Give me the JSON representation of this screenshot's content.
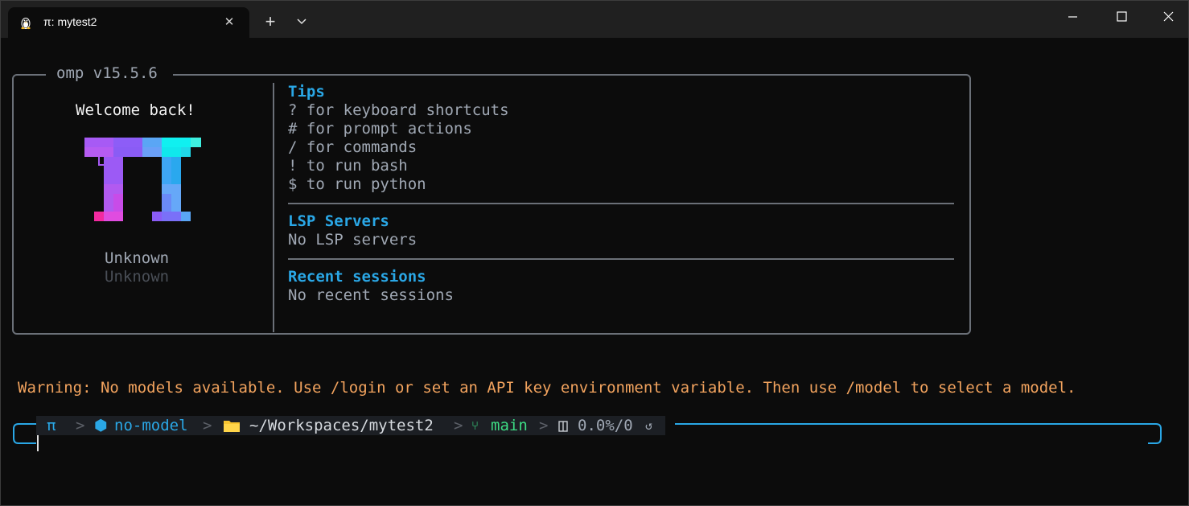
{
  "window": {
    "tab_title": "π: mytest2",
    "tab_icon": "linux-penguin-icon",
    "new_tab_label": "+",
    "close_tab_label": "✕"
  },
  "panel": {
    "title": "omp v15.5.6",
    "welcome": "Welcome back!",
    "model_name": "Unknown",
    "provider_name": "Unknown",
    "tips_heading": "Tips",
    "tips": [
      {
        "key": "?",
        "text": "for keyboard shortcuts"
      },
      {
        "key": "#",
        "text": "for prompt actions"
      },
      {
        "key": "/",
        "text": "for commands"
      },
      {
        "key": "!",
        "text": "to run bash"
      },
      {
        "key": "$",
        "text": "to run python"
      }
    ],
    "lsp_heading": "LSP Servers",
    "lsp_text": "No LSP servers",
    "recent_heading": "Recent sessions",
    "recent_text": "No recent sessions"
  },
  "warning": "Warning: No models available. Use /login or set an API key environment variable. Then use /model to select a model.",
  "status": {
    "pi": "π",
    "model": "no-model",
    "path": "~/Workspaces/mytest2",
    "branch": "main",
    "usage": "0.0%/0"
  },
  "colors": {
    "accent_blue": "#2aa7e6",
    "warning_orange": "#f2a35e",
    "branch_green": "#3ddc84",
    "terminal_bg": "#0c0c0c"
  }
}
